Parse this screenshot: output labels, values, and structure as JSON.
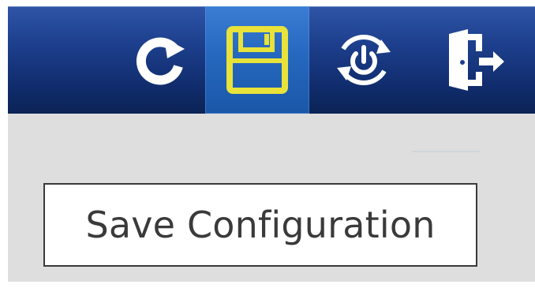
{
  "toolbar": {
    "buttons": [
      {
        "name": "refresh",
        "icon": "refresh-icon",
        "color": "#ffffff"
      },
      {
        "name": "save-configuration",
        "icon": "save-icon",
        "color": "#e8e23a",
        "active": true
      },
      {
        "name": "restart",
        "icon": "power-restart-icon",
        "color": "#ffffff"
      },
      {
        "name": "logout",
        "icon": "logout-door-icon",
        "color": "#ffffff"
      }
    ],
    "background_color": "#1d3f8d",
    "active_background_color": "#2668bf"
  },
  "tooltip": {
    "text": "Save Configuration"
  },
  "content": {
    "background_color": "#dedede"
  }
}
